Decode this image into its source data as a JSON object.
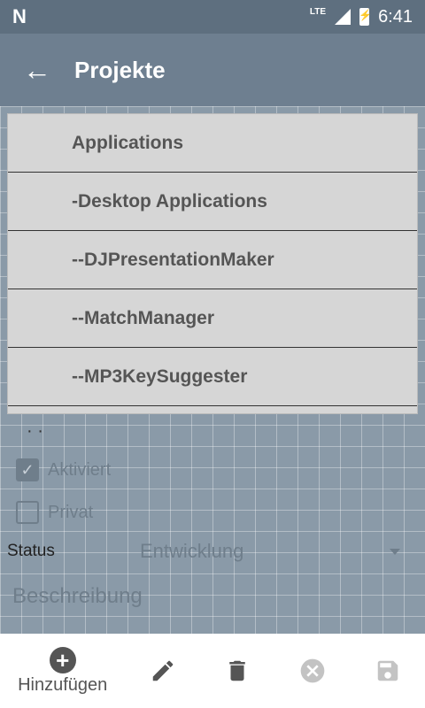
{
  "status_bar": {
    "network": "LTE",
    "time": "6:41"
  },
  "app_bar": {
    "back_icon": "←",
    "title": "Projekte"
  },
  "popup": {
    "items": [
      {
        "label": "Applications"
      },
      {
        "label": "-Desktop Applications"
      },
      {
        "label": "--DJPresentationMaker"
      },
      {
        "label": "--MatchManager"
      },
      {
        "label": "--MP3KeySuggester"
      }
    ]
  },
  "form": {
    "dots": "· ·",
    "aktiviert": {
      "label": "Aktiviert",
      "checked": true
    },
    "privat": {
      "label": "Privat",
      "checked": false
    },
    "status": {
      "label": "Status",
      "value": "Entwicklung"
    },
    "beschreibung": "Beschreibung"
  },
  "bottom_bar": {
    "add_label": "Hinzufügen",
    "icons": [
      "plus-icon",
      "edit-icon",
      "delete-icon",
      "cancel-icon",
      "save-icon"
    ]
  }
}
